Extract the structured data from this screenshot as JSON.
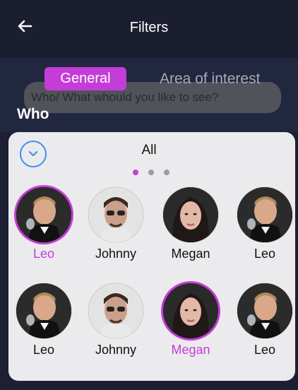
{
  "header": {
    "title": "Filters"
  },
  "tabs": [
    {
      "label": "General",
      "active": true
    },
    {
      "label": "Area of interest",
      "active": false
    }
  ],
  "search": {
    "placeholder": "Who/ What whould you like to see?"
  },
  "section": {
    "label": "Who"
  },
  "sheet": {
    "selector_label": "All",
    "page_dots": {
      "count": 3,
      "active_index": 0
    },
    "people": [
      [
        {
          "name": "Leo",
          "selected": true,
          "avatar": "leo"
        },
        {
          "name": "Johnny",
          "selected": false,
          "avatar": "johnny"
        },
        {
          "name": "Megan",
          "selected": false,
          "avatar": "megan"
        },
        {
          "name": "Leo",
          "selected": false,
          "avatar": "leo"
        }
      ],
      [
        {
          "name": "Leo",
          "selected": false,
          "avatar": "leo"
        },
        {
          "name": "Johnny",
          "selected": false,
          "avatar": "johnny"
        },
        {
          "name": "Megan",
          "selected": true,
          "avatar": "megan"
        },
        {
          "name": "Leo",
          "selected": false,
          "avatar": "leo"
        }
      ]
    ]
  },
  "colors": {
    "accent": "#c43dd8",
    "link": "#3d8ff6",
    "background": "#1d2033"
  }
}
